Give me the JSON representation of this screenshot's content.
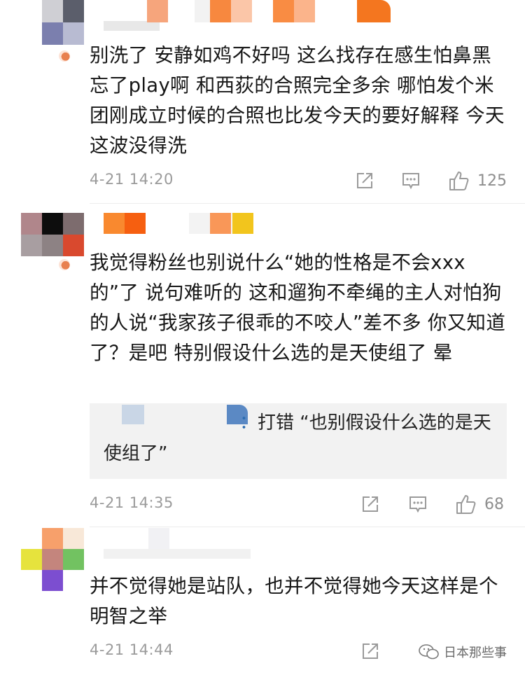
{
  "comments": [
    {
      "text": "别洗了 安静如鸡不好吗 这么找存在感生怕鼻黑忘了play啊 和西荻的合照完全多余 哪怕发个米团刚成立时候的合照也比发今天的要好解释 今天这波没得洗",
      "time": "4-21 14:20",
      "likes": "125"
    },
    {
      "text": "我觉得粉丝也别说什么“她的性格是不会xxx的”了 说句难听的 这和遛狗不牵绳的主人对怕狗的人说“我家孩子很乖的不咬人”差不多 你又知道了？是吧 特别假设什么选的是天使组了 晕",
      "reply": {
        "name_suffix": "：",
        "text": "打错 “也别假设什么选的是天使组了”"
      },
      "time": "4-21 14:35",
      "likes": "68"
    },
    {
      "text": "并不觉得她是站队，也并不觉得她今天这样是个明智之举",
      "time": "4-21 14:44",
      "likes": ""
    }
  ],
  "icons": {
    "share": "share-icon",
    "comment": "comment-icon",
    "like": "thumbs-up-icon",
    "watermark": "wechat-icon"
  },
  "watermark": "日本那些事",
  "colors": {
    "meta_gray": "#9b9b9b",
    "reply_bg": "#f2f2f2",
    "vip_orange": "#e8804f"
  }
}
